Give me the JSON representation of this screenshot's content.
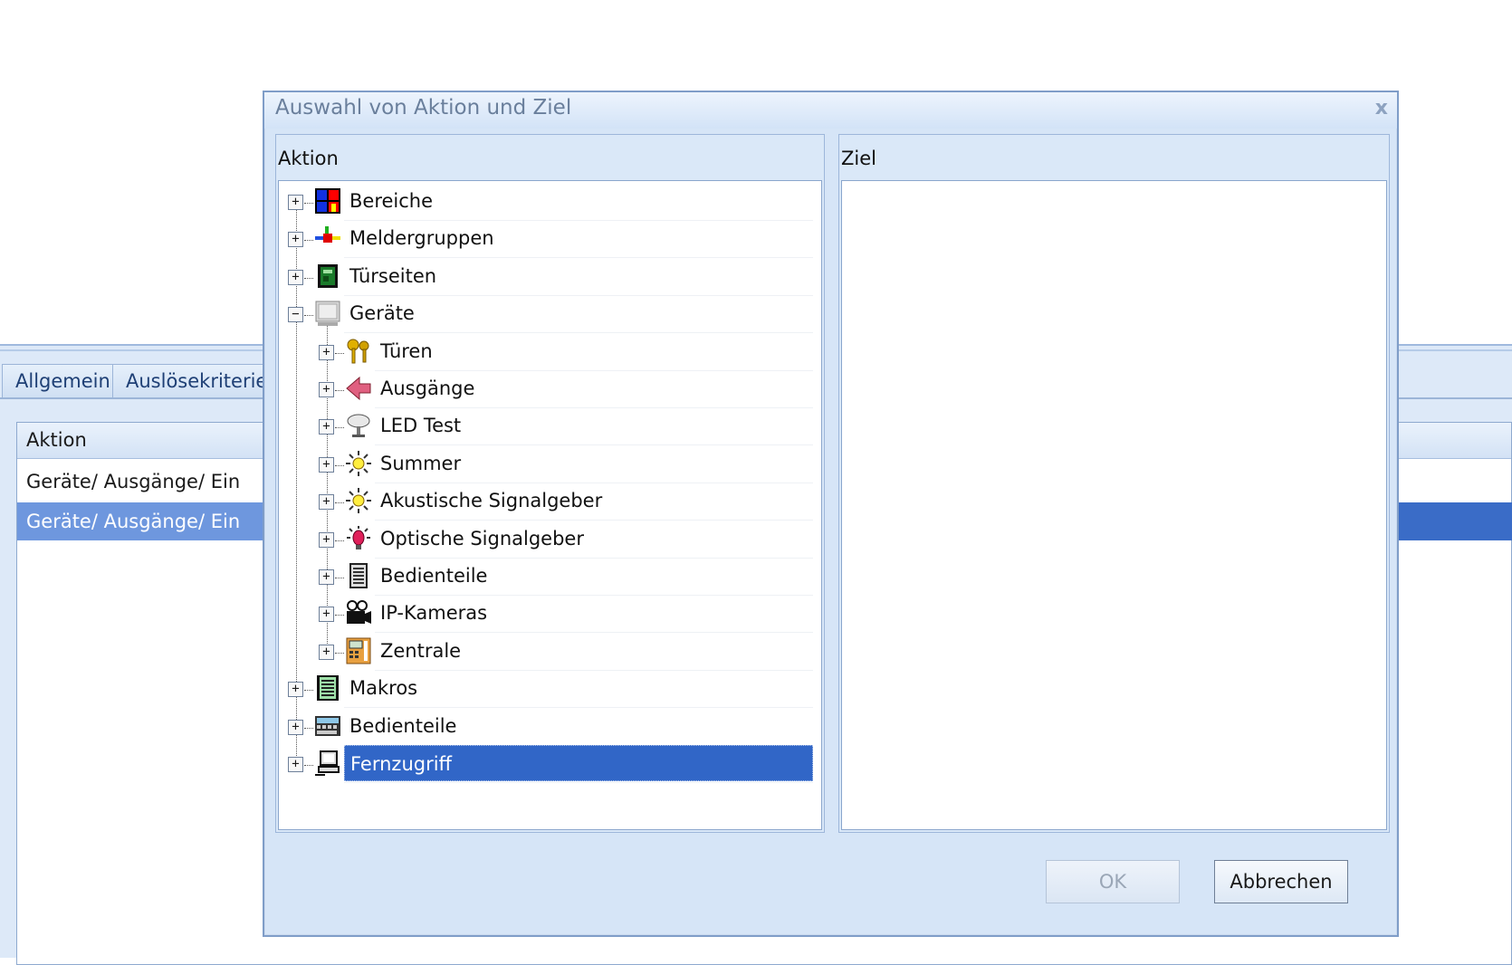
{
  "background": {
    "tabs": [
      {
        "label": "Allgemein"
      },
      {
        "label": "Auslösekriterien"
      }
    ],
    "grid": {
      "header": "Aktion",
      "rows": [
        {
          "text": "Geräte/ Ausgänge/ Ein",
          "selected": false
        },
        {
          "text": "Geräte/ Ausgänge/ Ein",
          "selected": true
        }
      ]
    }
  },
  "dialog": {
    "title": "Auswahl von Aktion und Ziel",
    "close": "x",
    "aktion_label": "Aktion",
    "ziel_label": "Ziel",
    "tree": [
      {
        "label": "Bereiche",
        "icon": "areas-icon",
        "level": 0,
        "expander": "+"
      },
      {
        "label": "Meldergruppen",
        "icon": "detector-groups-icon",
        "level": 0,
        "expander": "+"
      },
      {
        "label": "Türseiten",
        "icon": "door-side-icon",
        "level": 0,
        "expander": "+"
      },
      {
        "label": "Geräte",
        "icon": "devices-icon",
        "level": 0,
        "expander": "−"
      },
      {
        "label": "Türen",
        "icon": "keys-icon",
        "level": 1,
        "expander": "+"
      },
      {
        "label": "Ausgänge",
        "icon": "output-arrow-icon",
        "level": 1,
        "expander": "+"
      },
      {
        "label": "LED Test",
        "icon": "led-icon",
        "level": 1,
        "expander": "+"
      },
      {
        "label": "Summer",
        "icon": "buzzer-icon",
        "level": 1,
        "expander": "+"
      },
      {
        "label": "Akustische Signalgeber",
        "icon": "acoustic-signal-icon",
        "level": 1,
        "expander": "+"
      },
      {
        "label": "Optische Signalgeber",
        "icon": "optical-signal-icon",
        "level": 1,
        "expander": "+"
      },
      {
        "label": "Bedienteile",
        "icon": "keypad-icon",
        "level": 1,
        "expander": "+"
      },
      {
        "label": "IP-Kameras",
        "icon": "camera-icon",
        "level": 1,
        "expander": "+"
      },
      {
        "label": "Zentrale",
        "icon": "control-panel-icon",
        "level": 1,
        "expander": "+"
      },
      {
        "label": "Makros",
        "icon": "macros-icon",
        "level": 0,
        "expander": "+"
      },
      {
        "label": "Bedienteile",
        "icon": "keyboard-icon",
        "level": 0,
        "expander": "+"
      },
      {
        "label": "Fernzugriff",
        "icon": "remote-computer-icon",
        "level": 0,
        "expander": "+",
        "selected": true
      }
    ],
    "buttons": {
      "ok": "OK",
      "cancel": "Abbrechen"
    }
  }
}
